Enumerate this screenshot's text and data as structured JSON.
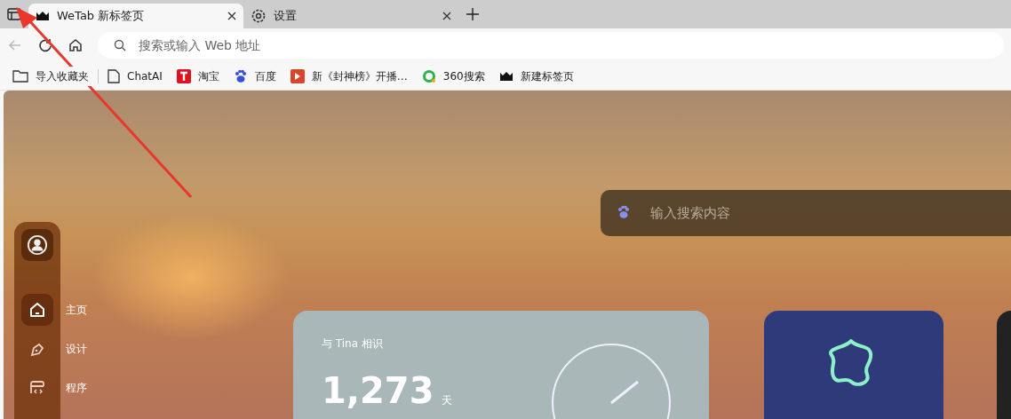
{
  "tabs": [
    {
      "label": "WeTab 新标签页",
      "selected": true,
      "kind": "crown"
    },
    {
      "label": "设置",
      "selected": false,
      "kind": "gear"
    }
  ],
  "address_bar": {
    "placeholder": "搜索或输入 Web 地址"
  },
  "bookmarks": [
    {
      "label": "导入收藏夹",
      "kind": "import"
    },
    {
      "label": "ChatAI",
      "kind": "page"
    },
    {
      "label": "淘宝",
      "kind": "taobao"
    },
    {
      "label": "百度",
      "kind": "paw"
    },
    {
      "label": "新《封神榜》开播…",
      "kind": "video"
    },
    {
      "label": "360搜索",
      "kind": "ring"
    },
    {
      "label": "新建标签页",
      "kind": "crown"
    }
  ],
  "search": {
    "placeholder": "输入搜索内容"
  },
  "sidebar": {
    "items": [
      {
        "label": "主页",
        "kind": "home",
        "selected": true
      },
      {
        "label": "设计",
        "kind": "pen",
        "selected": false
      },
      {
        "label": "程序",
        "kind": "code",
        "selected": false
      }
    ]
  },
  "anniversary_card": {
    "title": "与 Tina 相识",
    "count": "1,273",
    "unit": "天"
  }
}
